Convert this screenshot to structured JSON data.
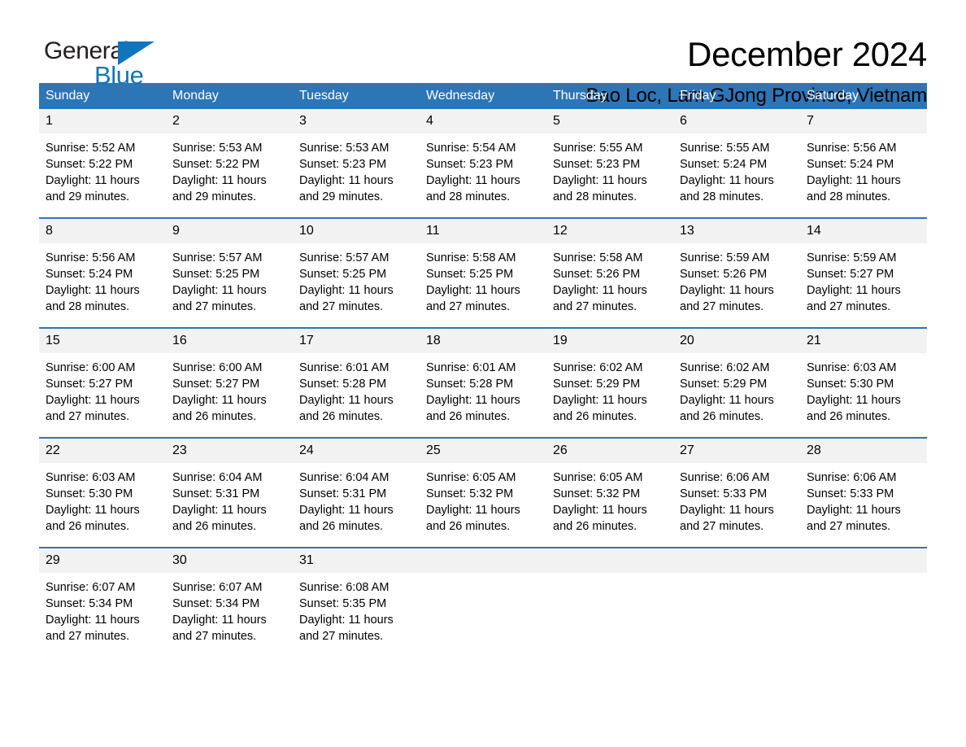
{
  "brand": {
    "name_part1": "General",
    "name_part2": "Blue",
    "accent_color": "#1275bc"
  },
  "header": {
    "title": "December 2024",
    "location": "Bao Loc, Lam GJong Province, Vietnam"
  },
  "theme": {
    "header_blue": "#2e75b6",
    "date_band_gray": "#f2f2f2"
  },
  "weekdays": [
    "Sunday",
    "Monday",
    "Tuesday",
    "Wednesday",
    "Thursday",
    "Friday",
    "Saturday"
  ],
  "weeks": [
    {
      "days": [
        {
          "date": "1",
          "sunrise": "Sunrise: 5:52 AM",
          "sunset": "Sunset: 5:22 PM",
          "daylight_line1": "Daylight: 11 hours",
          "daylight_line2": "and 29 minutes."
        },
        {
          "date": "2",
          "sunrise": "Sunrise: 5:53 AM",
          "sunset": "Sunset: 5:22 PM",
          "daylight_line1": "Daylight: 11 hours",
          "daylight_line2": "and 29 minutes."
        },
        {
          "date": "3",
          "sunrise": "Sunrise: 5:53 AM",
          "sunset": "Sunset: 5:23 PM",
          "daylight_line1": "Daylight: 11 hours",
          "daylight_line2": "and 29 minutes."
        },
        {
          "date": "4",
          "sunrise": "Sunrise: 5:54 AM",
          "sunset": "Sunset: 5:23 PM",
          "daylight_line1": "Daylight: 11 hours",
          "daylight_line2": "and 28 minutes."
        },
        {
          "date": "5",
          "sunrise": "Sunrise: 5:55 AM",
          "sunset": "Sunset: 5:23 PM",
          "daylight_line1": "Daylight: 11 hours",
          "daylight_line2": "and 28 minutes."
        },
        {
          "date": "6",
          "sunrise": "Sunrise: 5:55 AM",
          "sunset": "Sunset: 5:24 PM",
          "daylight_line1": "Daylight: 11 hours",
          "daylight_line2": "and 28 minutes."
        },
        {
          "date": "7",
          "sunrise": "Sunrise: 5:56 AM",
          "sunset": "Sunset: 5:24 PM",
          "daylight_line1": "Daylight: 11 hours",
          "daylight_line2": "and 28 minutes."
        }
      ]
    },
    {
      "days": [
        {
          "date": "8",
          "sunrise": "Sunrise: 5:56 AM",
          "sunset": "Sunset: 5:24 PM",
          "daylight_line1": "Daylight: 11 hours",
          "daylight_line2": "and 28 minutes."
        },
        {
          "date": "9",
          "sunrise": "Sunrise: 5:57 AM",
          "sunset": "Sunset: 5:25 PM",
          "daylight_line1": "Daylight: 11 hours",
          "daylight_line2": "and 27 minutes."
        },
        {
          "date": "10",
          "sunrise": "Sunrise: 5:57 AM",
          "sunset": "Sunset: 5:25 PM",
          "daylight_line1": "Daylight: 11 hours",
          "daylight_line2": "and 27 minutes."
        },
        {
          "date": "11",
          "sunrise": "Sunrise: 5:58 AM",
          "sunset": "Sunset: 5:25 PM",
          "daylight_line1": "Daylight: 11 hours",
          "daylight_line2": "and 27 minutes."
        },
        {
          "date": "12",
          "sunrise": "Sunrise: 5:58 AM",
          "sunset": "Sunset: 5:26 PM",
          "daylight_line1": "Daylight: 11 hours",
          "daylight_line2": "and 27 minutes."
        },
        {
          "date": "13",
          "sunrise": "Sunrise: 5:59 AM",
          "sunset": "Sunset: 5:26 PM",
          "daylight_line1": "Daylight: 11 hours",
          "daylight_line2": "and 27 minutes."
        },
        {
          "date": "14",
          "sunrise": "Sunrise: 5:59 AM",
          "sunset": "Sunset: 5:27 PM",
          "daylight_line1": "Daylight: 11 hours",
          "daylight_line2": "and 27 minutes."
        }
      ]
    },
    {
      "days": [
        {
          "date": "15",
          "sunrise": "Sunrise: 6:00 AM",
          "sunset": "Sunset: 5:27 PM",
          "daylight_line1": "Daylight: 11 hours",
          "daylight_line2": "and 27 minutes."
        },
        {
          "date": "16",
          "sunrise": "Sunrise: 6:00 AM",
          "sunset": "Sunset: 5:27 PM",
          "daylight_line1": "Daylight: 11 hours",
          "daylight_line2": "and 26 minutes."
        },
        {
          "date": "17",
          "sunrise": "Sunrise: 6:01 AM",
          "sunset": "Sunset: 5:28 PM",
          "daylight_line1": "Daylight: 11 hours",
          "daylight_line2": "and 26 minutes."
        },
        {
          "date": "18",
          "sunrise": "Sunrise: 6:01 AM",
          "sunset": "Sunset: 5:28 PM",
          "daylight_line1": "Daylight: 11 hours",
          "daylight_line2": "and 26 minutes."
        },
        {
          "date": "19",
          "sunrise": "Sunrise: 6:02 AM",
          "sunset": "Sunset: 5:29 PM",
          "daylight_line1": "Daylight: 11 hours",
          "daylight_line2": "and 26 minutes."
        },
        {
          "date": "20",
          "sunrise": "Sunrise: 6:02 AM",
          "sunset": "Sunset: 5:29 PM",
          "daylight_line1": "Daylight: 11 hours",
          "daylight_line2": "and 26 minutes."
        },
        {
          "date": "21",
          "sunrise": "Sunrise: 6:03 AM",
          "sunset": "Sunset: 5:30 PM",
          "daylight_line1": "Daylight: 11 hours",
          "daylight_line2": "and 26 minutes."
        }
      ]
    },
    {
      "days": [
        {
          "date": "22",
          "sunrise": "Sunrise: 6:03 AM",
          "sunset": "Sunset: 5:30 PM",
          "daylight_line1": "Daylight: 11 hours",
          "daylight_line2": "and 26 minutes."
        },
        {
          "date": "23",
          "sunrise": "Sunrise: 6:04 AM",
          "sunset": "Sunset: 5:31 PM",
          "daylight_line1": "Daylight: 11 hours",
          "daylight_line2": "and 26 minutes."
        },
        {
          "date": "24",
          "sunrise": "Sunrise: 6:04 AM",
          "sunset": "Sunset: 5:31 PM",
          "daylight_line1": "Daylight: 11 hours",
          "daylight_line2": "and 26 minutes."
        },
        {
          "date": "25",
          "sunrise": "Sunrise: 6:05 AM",
          "sunset": "Sunset: 5:32 PM",
          "daylight_line1": "Daylight: 11 hours",
          "daylight_line2": "and 26 minutes."
        },
        {
          "date": "26",
          "sunrise": "Sunrise: 6:05 AM",
          "sunset": "Sunset: 5:32 PM",
          "daylight_line1": "Daylight: 11 hours",
          "daylight_line2": "and 26 minutes."
        },
        {
          "date": "27",
          "sunrise": "Sunrise: 6:06 AM",
          "sunset": "Sunset: 5:33 PM",
          "daylight_line1": "Daylight: 11 hours",
          "daylight_line2": "and 27 minutes."
        },
        {
          "date": "28",
          "sunrise": "Sunrise: 6:06 AM",
          "sunset": "Sunset: 5:33 PM",
          "daylight_line1": "Daylight: 11 hours",
          "daylight_line2": "and 27 minutes."
        }
      ]
    },
    {
      "days": [
        {
          "date": "29",
          "sunrise": "Sunrise: 6:07 AM",
          "sunset": "Sunset: 5:34 PM",
          "daylight_line1": "Daylight: 11 hours",
          "daylight_line2": "and 27 minutes."
        },
        {
          "date": "30",
          "sunrise": "Sunrise: 6:07 AM",
          "sunset": "Sunset: 5:34 PM",
          "daylight_line1": "Daylight: 11 hours",
          "daylight_line2": "and 27 minutes."
        },
        {
          "date": "31",
          "sunrise": "Sunrise: 6:08 AM",
          "sunset": "Sunset: 5:35 PM",
          "daylight_line1": "Daylight: 11 hours",
          "daylight_line2": "and 27 minutes."
        },
        {
          "date": "",
          "sunrise": "",
          "sunset": "",
          "daylight_line1": "",
          "daylight_line2": ""
        },
        {
          "date": "",
          "sunrise": "",
          "sunset": "",
          "daylight_line1": "",
          "daylight_line2": ""
        },
        {
          "date": "",
          "sunrise": "",
          "sunset": "",
          "daylight_line1": "",
          "daylight_line2": ""
        },
        {
          "date": "",
          "sunrise": "",
          "sunset": "",
          "daylight_line1": "",
          "daylight_line2": ""
        }
      ]
    }
  ]
}
